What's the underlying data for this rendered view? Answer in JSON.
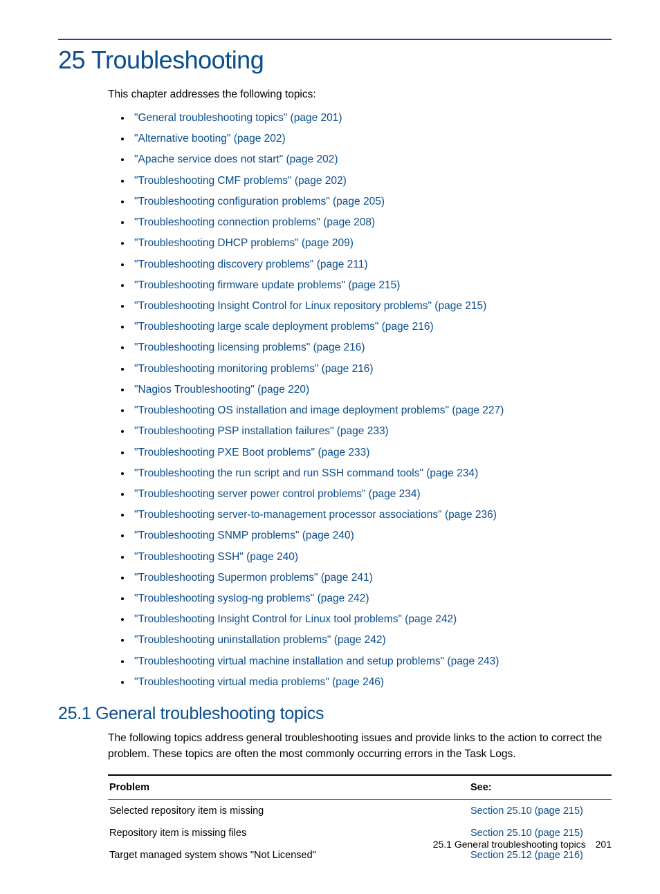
{
  "chapter_title": "25 Troubleshooting",
  "intro": "This chapter addresses the following topics:",
  "toc": [
    "\"General troubleshooting topics\" (page 201)",
    "\"Alternative booting\" (page 202)",
    "\"Apache service does not start\" (page 202)",
    "\"Troubleshooting CMF problems\" (page 202)",
    "\"Troubleshooting configuration problems\" (page 205)",
    "\"Troubleshooting connection problems\" (page 208)",
    "\"Troubleshooting DHCP problems\" (page 209)",
    "\"Troubleshooting discovery problems\" (page 211)",
    "\"Troubleshooting firmware update problems\" (page 215)",
    "\"Troubleshooting Insight Control for Linux repository problems\" (page 215)",
    "\"Troubleshooting large scale deployment problems\" (page 216)",
    "\"Troubleshooting licensing problems\" (page 216)",
    "\"Troubleshooting monitoring problems\" (page 216)",
    "\"Nagios Troubleshooting\" (page 220)",
    "\"Troubleshooting OS installation and image deployment problems\" (page 227)",
    "\"Troubleshooting PSP installation failures\" (page 233)",
    "\"Troubleshooting PXE Boot problems\" (page 233)",
    "\"Troubleshooting the run script and run SSH command tools\" (page 234)",
    "\"Troubleshooting server power control problems\" (page 234)",
    "\"Troubleshooting server-to-management processor associations\" (page 236)",
    "\"Troubleshooting SNMP problems\" (page 240)",
    "\"Troubleshooting SSH\" (page 240)",
    "\"Troubleshooting Supermon problems\" (page 241)",
    "\"Troubleshooting syslog-ng problems\" (page 242)",
    "\"Troubleshooting Insight Control for Linux tool problems\" (page 242)",
    "\"Troubleshooting uninstallation problems\" (page 242)",
    "\"Troubleshooting virtual machine installation and setup problems\" (page 243)",
    "\"Troubleshooting virtual media problems\" (page 246)"
  ],
  "section_title": "25.1 General troubleshooting topics",
  "section_intro": "The following topics address general troubleshooting issues and provide links to the action to correct the problem. These topics are often the most commonly occurring errors in the Task Logs.",
  "table": {
    "headers": {
      "problem": "Problem",
      "see": "See:"
    },
    "rows": [
      {
        "problem": "Selected repository item is missing",
        "see": "Section 25.10 (page 215)"
      },
      {
        "problem": "Repository item is missing files",
        "see": "Section 25.10 (page 215)"
      },
      {
        "problem": "Target managed system shows \"Not Licensed\"",
        "see": "Section 25.12 (page 216)"
      }
    ]
  },
  "footer": {
    "label": "25.1 General troubleshooting topics",
    "page": "201"
  }
}
